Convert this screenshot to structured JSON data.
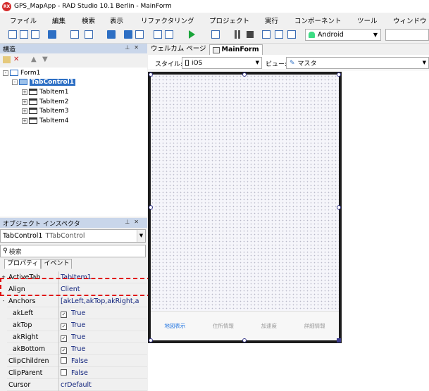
{
  "window": {
    "app_icon": "RX",
    "title": "GPS_MapApp - RAD Studio 10.1 Berlin - MainForm"
  },
  "menu": [
    "ファイル",
    "編集",
    "検索",
    "表示",
    "リファクタリング",
    "プロジェクト",
    "実行",
    "コンポーネント",
    "ツール",
    "ウィンドウ"
  ],
  "toolbar": {
    "platform": "Android",
    "search_value": ""
  },
  "structure": {
    "title": "構造",
    "tree": [
      {
        "label": "Form1",
        "level": 0,
        "expander": "-"
      },
      {
        "label": "TabControl1",
        "level": 1,
        "expander": "-",
        "selected": true
      },
      {
        "label": "TabItem1",
        "level": 2,
        "expander": "+"
      },
      {
        "label": "TabItem2",
        "level": 2,
        "expander": "+"
      },
      {
        "label": "TabItem3",
        "level": 2,
        "expander": "+"
      },
      {
        "label": "TabItem4",
        "level": 2,
        "expander": "+"
      }
    ]
  },
  "inspector": {
    "title": "オブジェクト インスペクタ",
    "object_name": "TabControl1",
    "object_class": "TTabControl",
    "search_placeholder": "検索",
    "tabs": [
      "プロパティ",
      "イベント"
    ],
    "props": [
      {
        "name": "ActiveTab",
        "value": "TabItem1",
        "gutter": "+"
      },
      {
        "name": "Align",
        "value": "Client",
        "gutter": ""
      },
      {
        "name": "Anchors",
        "value": "[akLeft,akTop,akRight,a",
        "gutter": "-"
      },
      {
        "name": "akLeft",
        "value": "True",
        "gutter": "",
        "check": true,
        "indent": true
      },
      {
        "name": "akTop",
        "value": "True",
        "gutter": "",
        "check": true,
        "indent": true
      },
      {
        "name": "akRight",
        "value": "True",
        "gutter": "",
        "check": true,
        "indent": true
      },
      {
        "name": "akBottom",
        "value": "True",
        "gutter": "",
        "check": true,
        "indent": true
      },
      {
        "name": "ClipChildren",
        "value": "False",
        "gutter": "",
        "check": false
      },
      {
        "name": "ClipParent",
        "value": "False",
        "gutter": "",
        "check": false
      },
      {
        "name": "Cursor",
        "value": "crDefault",
        "gutter": ""
      }
    ]
  },
  "editor": {
    "tabs": [
      "ウェルカム ページ",
      "MainForm"
    ],
    "style_label": "スタイル:",
    "style_value": "iOS",
    "view_label": "ビュー:",
    "view_value": "マスタ",
    "tab_bar": [
      "地図表示",
      "住所情報",
      "加速度",
      "詳細情報"
    ]
  },
  "colors": {
    "selection": "#2d6fc4",
    "highlight": "#e01010",
    "active_tab_text": "#2a7ae2"
  }
}
